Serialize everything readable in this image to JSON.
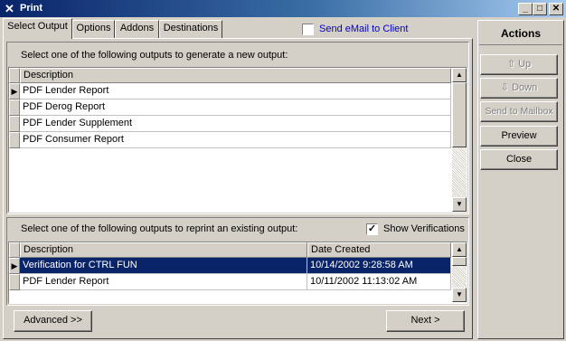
{
  "window": {
    "title": "Print",
    "app_icon": "x-logo-icon",
    "controls": [
      "minimize-icon",
      "maximize-icon",
      "close-icon"
    ]
  },
  "tabs": [
    {
      "label": "Select Output",
      "active": true
    },
    {
      "label": "Options",
      "active": false
    },
    {
      "label": "Addons",
      "active": false
    },
    {
      "label": "Destinations",
      "active": false
    }
  ],
  "email": {
    "label": "Send eMail to Client",
    "checked": false,
    "color": "#0000cc"
  },
  "new_output": {
    "instruction": "Select one of the following outputs to generate a new output:",
    "header_description": "Description",
    "rows": [
      {
        "description": "PDF Lender Report",
        "current": true
      },
      {
        "description": "PDF Derog Report",
        "current": false
      },
      {
        "description": "PDF Lender Supplement",
        "current": false
      },
      {
        "description": "PDF Consumer Report",
        "current": false
      }
    ]
  },
  "existing_output": {
    "instruction": "Select one of the following outputs to reprint an existing output:",
    "show_verifications_label": "Show Verifications",
    "show_verifications_checked": true,
    "header_description": "Description",
    "header_date": "Date Created",
    "rows": [
      {
        "description": "Verification for CTRL FUN",
        "date": "10/14/2002 9:28:58 AM",
        "selected": true
      },
      {
        "description": "PDF Lender Report",
        "date": "10/11/2002 11:13:02 AM",
        "selected": false
      }
    ]
  },
  "bottom_buttons": {
    "advanced": "Advanced >>",
    "next": "Next  >"
  },
  "actions": {
    "title": "Actions",
    "up": "Up",
    "down": "Down",
    "send_to_mailbox": "Send to Mailbox",
    "preview": "Preview",
    "close": "Close"
  },
  "colors": {
    "selection": "#0a246a",
    "titlebar": "#0a246a",
    "face": "#d4d0c8"
  }
}
